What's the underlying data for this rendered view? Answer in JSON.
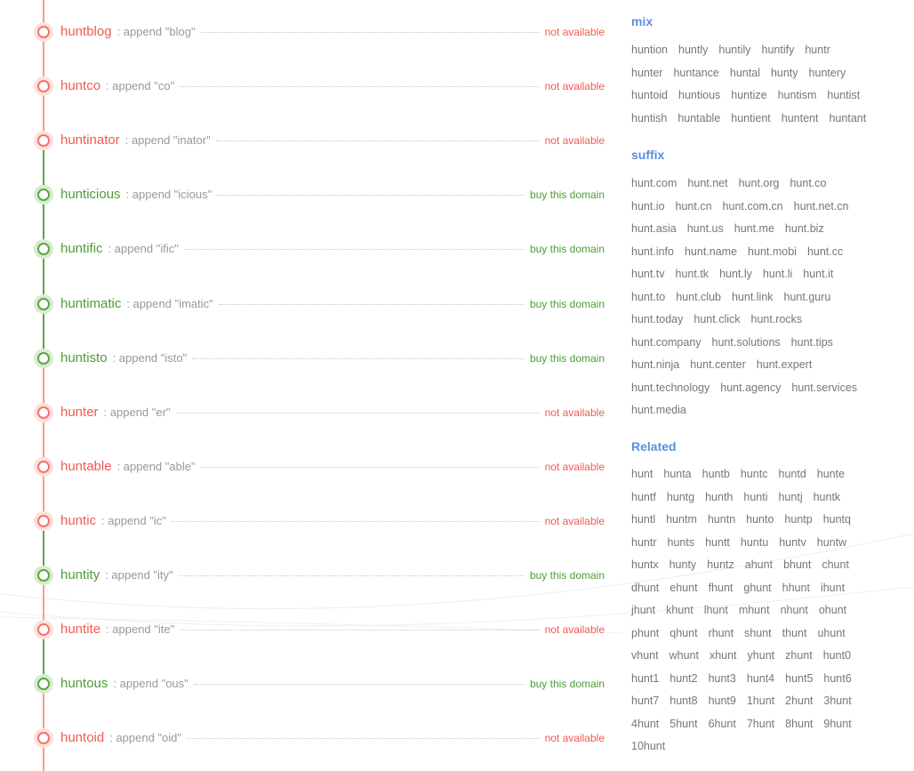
{
  "domains": [
    {
      "name": "huntblog",
      "append": ": append \"blog\"",
      "status": "not available",
      "available": false
    },
    {
      "name": "huntco",
      "append": ": append \"co\"",
      "status": "not available",
      "available": false
    },
    {
      "name": "huntinator",
      "append": ": append \"inator\"",
      "status": "not available",
      "available": false
    },
    {
      "name": "hunticious",
      "append": ": append \"icious\"",
      "status": "buy this domain",
      "available": true
    },
    {
      "name": "huntific",
      "append": ": append \"ific\"",
      "status": "buy this domain",
      "available": true
    },
    {
      "name": "huntimatic",
      "append": ": append \"imatic\"",
      "status": "buy this domain",
      "available": true
    },
    {
      "name": "huntisto",
      "append": ": append \"isto\"",
      "status": "buy this domain",
      "available": true
    },
    {
      "name": "hunter",
      "append": ": append \"er\"",
      "status": "not available",
      "available": false
    },
    {
      "name": "huntable",
      "append": ": append \"able\"",
      "status": "not available",
      "available": false
    },
    {
      "name": "huntic",
      "append": ": append \"ic\"",
      "status": "not available",
      "available": false
    },
    {
      "name": "huntity",
      "append": ": append \"ity\"",
      "status": "buy this domain",
      "available": true
    },
    {
      "name": "huntite",
      "append": ": append \"ite\"",
      "status": "not available",
      "available": false
    },
    {
      "name": "huntous",
      "append": ": append \"ous\"",
      "status": "buy this domain",
      "available": true
    },
    {
      "name": "huntoid",
      "append": ": append \"oid\"",
      "status": "not available",
      "available": false
    }
  ],
  "colors": {
    "unavailable": "#ef5b52",
    "available": "#4e9c37",
    "section_title": "#5b8fe0"
  },
  "sections": [
    {
      "title": "mix",
      "lines": [
        [
          "huntion",
          "huntly",
          "huntily",
          "huntify",
          "huntr"
        ],
        [
          "hunter",
          "huntance",
          "huntal",
          "hunty",
          "huntery"
        ],
        [
          "huntoid",
          "huntious",
          "huntize",
          "huntism",
          "huntist"
        ],
        [
          "huntish",
          "huntable",
          "huntient",
          "huntent",
          "huntant"
        ]
      ]
    },
    {
      "title": "suffix",
      "lines": [
        [
          "hunt.com",
          "hunt.net",
          "hunt.org",
          "hunt.co"
        ],
        [
          "hunt.io",
          "hunt.cn",
          "hunt.com.cn",
          "hunt.net.cn"
        ],
        [
          "hunt.asia",
          "hunt.us",
          "hunt.me",
          "hunt.biz"
        ],
        [
          "hunt.info",
          "hunt.name",
          "hunt.mobi",
          "hunt.cc"
        ],
        [
          "hunt.tv",
          "hunt.tk",
          "hunt.ly",
          "hunt.li",
          "hunt.it"
        ],
        [
          "hunt.to",
          "hunt.club",
          "hunt.link",
          "hunt.guru"
        ],
        [
          "hunt.today",
          "hunt.click",
          "hunt.rocks"
        ],
        [
          "hunt.company",
          "hunt.solutions",
          "hunt.tips"
        ],
        [
          "hunt.ninja",
          "hunt.center",
          "hunt.expert"
        ],
        [
          "hunt.technology",
          "hunt.agency",
          "hunt.services"
        ],
        [
          "hunt.media"
        ]
      ]
    },
    {
      "title": "Related",
      "lines": [
        [
          "hunt",
          "hunta",
          "huntb",
          "huntc",
          "huntd",
          "hunte"
        ],
        [
          "huntf",
          "huntg",
          "hunth",
          "hunti",
          "huntj",
          "huntk"
        ],
        [
          "huntl",
          "huntm",
          "huntn",
          "hunto",
          "huntp",
          "huntq"
        ],
        [
          "huntr",
          "hunts",
          "huntt",
          "huntu",
          "huntv",
          "huntw"
        ],
        [
          "huntx",
          "hunty",
          "huntz",
          "ahunt",
          "bhunt",
          "chunt"
        ],
        [
          "dhunt",
          "ehunt",
          "fhunt",
          "ghunt",
          "hhunt",
          "ihunt"
        ],
        [
          "jhunt",
          "khunt",
          "lhunt",
          "mhunt",
          "nhunt",
          "ohunt"
        ],
        [
          "phunt",
          "qhunt",
          "rhunt",
          "shunt",
          "thunt",
          "uhunt"
        ],
        [
          "vhunt",
          "whunt",
          "xhunt",
          "yhunt",
          "zhunt",
          "hunt0"
        ],
        [
          "hunt1",
          "hunt2",
          "hunt3",
          "hunt4",
          "hunt5",
          "hunt6"
        ],
        [
          "hunt7",
          "hunt8",
          "hunt9",
          "1hunt",
          "2hunt",
          "3hunt"
        ],
        [
          "4hunt",
          "5hunt",
          "6hunt",
          "7hunt",
          "8hunt",
          "9hunt"
        ],
        [
          "10hunt"
        ]
      ]
    }
  ]
}
